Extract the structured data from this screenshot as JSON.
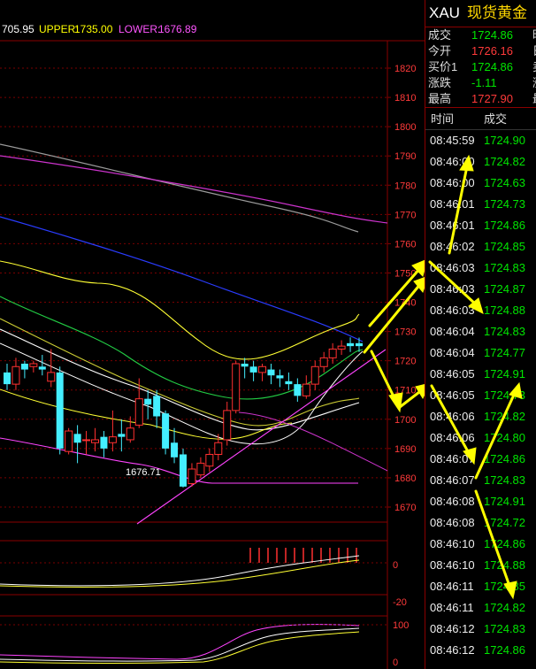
{
  "indicator": {
    "mid": "705.95",
    "upper_label": "UPPER:",
    "upper_value": "1735.00",
    "lower_label": "LOWER:",
    "lower_value": "1676.89",
    "colors": {
      "mid": "#ffffff",
      "upper": "#ffff00",
      "lower": "#ff55ff"
    }
  },
  "chart_data": {
    "type": "candlestick",
    "y_ticks": [
      "1820",
      "1810",
      "1800",
      "1790",
      "1780",
      "1770",
      "1760",
      "1750",
      "1740",
      "1730",
      "1720",
      "1710",
      "1700",
      "1690",
      "1680",
      "1670"
    ],
    "ylim": [
      1664,
      1825
    ],
    "min_marker": "1676.71",
    "candles": [
      {
        "o": 1716,
        "c": 1712,
        "h": 1719,
        "l": 1710
      },
      {
        "o": 1712,
        "c": 1718,
        "h": 1721,
        "l": 1710
      },
      {
        "o": 1719,
        "c": 1717,
        "h": 1720,
        "l": 1714
      },
      {
        "o": 1718,
        "c": 1719,
        "h": 1720,
        "l": 1716
      },
      {
        "o": 1718,
        "c": 1717,
        "h": 1722,
        "l": 1715
      },
      {
        "o": 1713,
        "c": 1716,
        "h": 1724,
        "l": 1711
      },
      {
        "o": 1716,
        "c": 1690,
        "h": 1718,
        "l": 1688
      },
      {
        "o": 1689,
        "c": 1696,
        "h": 1697,
        "l": 1688
      },
      {
        "o": 1695,
        "c": 1692,
        "h": 1698,
        "l": 1685
      },
      {
        "o": 1693,
        "c": 1693,
        "h": 1696,
        "l": 1688
      },
      {
        "o": 1692,
        "c": 1693,
        "h": 1697,
        "l": 1689
      },
      {
        "o": 1694,
        "c": 1690,
        "h": 1696,
        "l": 1687
      },
      {
        "o": 1692,
        "c": 1694,
        "h": 1703,
        "l": 1689
      },
      {
        "o": 1695,
        "c": 1694,
        "h": 1700,
        "l": 1689
      },
      {
        "o": 1693,
        "c": 1697,
        "h": 1701,
        "l": 1692
      },
      {
        "o": 1698,
        "c": 1707,
        "h": 1714,
        "l": 1697
      },
      {
        "o": 1707,
        "c": 1705,
        "h": 1710,
        "l": 1700
      },
      {
        "o": 1708,
        "c": 1701,
        "h": 1710,
        "l": 1697
      },
      {
        "o": 1702,
        "c": 1690,
        "h": 1703,
        "l": 1688
      },
      {
        "o": 1692,
        "c": 1687,
        "h": 1697,
        "l": 1685
      },
      {
        "o": 1688,
        "c": 1677,
        "h": 1690,
        "l": 1676.7
      },
      {
        "o": 1678,
        "c": 1683,
        "h": 1685,
        "l": 1677
      },
      {
        "o": 1681,
        "c": 1685,
        "h": 1687,
        "l": 1680
      },
      {
        "o": 1684,
        "c": 1688,
        "h": 1690,
        "l": 1682
      },
      {
        "o": 1688,
        "c": 1692,
        "h": 1695,
        "l": 1686
      },
      {
        "o": 1693,
        "c": 1703,
        "h": 1706,
        "l": 1691
      },
      {
        "o": 1703,
        "c": 1719,
        "h": 1720,
        "l": 1702
      },
      {
        "o": 1719,
        "c": 1718,
        "h": 1721,
        "l": 1714
      },
      {
        "o": 1718,
        "c": 1716,
        "h": 1720,
        "l": 1713
      },
      {
        "o": 1716,
        "c": 1718,
        "h": 1719,
        "l": 1713
      },
      {
        "o": 1717,
        "c": 1715,
        "h": 1719,
        "l": 1712
      },
      {
        "o": 1715,
        "c": 1714,
        "h": 1717,
        "l": 1711
      },
      {
        "o": 1713,
        "c": 1712,
        "h": 1716,
        "l": 1710
      },
      {
        "o": 1712,
        "c": 1708,
        "h": 1714,
        "l": 1706
      },
      {
        "o": 1708,
        "c": 1712,
        "h": 1715,
        "l": 1707
      },
      {
        "o": 1712,
        "c": 1718,
        "h": 1720,
        "l": 1710
      },
      {
        "o": 1718,
        "c": 1721,
        "h": 1723,
        "l": 1716
      },
      {
        "o": 1721,
        "c": 1724,
        "h": 1726,
        "l": 1719
      },
      {
        "o": 1724,
        "c": 1725,
        "h": 1727,
        "l": 1722
      },
      {
        "o": 1726,
        "c": 1725,
        "h": 1728,
        "l": 1723
      },
      {
        "o": 1726,
        "c": 1725,
        "h": 1727.9,
        "l": 1723
      }
    ],
    "sub1_ticks": [
      "0",
      "-20"
    ],
    "sub2_ticks": [
      "100",
      "0"
    ]
  },
  "quote": {
    "symbol": "XAU",
    "name": "现货黄金",
    "rows": [
      {
        "label": "成交",
        "value": "1724.86",
        "color": "dn",
        "cut": "昨"
      },
      {
        "label": "今开",
        "value": "1726.16",
        "color": "up",
        "cut": "日"
      },
      {
        "label": "买价1",
        "value": "1724.86",
        "color": "dn",
        "cut": "卖"
      },
      {
        "label": "涨跌",
        "value": "-1.11",
        "color": "dn",
        "cut": "涨"
      },
      {
        "label": "最高",
        "value": "1727.90",
        "color": "up",
        "cut": "最"
      }
    ]
  },
  "ticks": {
    "col_time": "时间",
    "col_price": "成交",
    "rows": [
      {
        "t": "08:45:59",
        "p": "1724.90",
        "c": "dn"
      },
      {
        "t": "08:46:00",
        "p": "1724.82",
        "c": "dn"
      },
      {
        "t": "08:46:00",
        "p": "1724.63",
        "c": "dn"
      },
      {
        "t": "08:46:01",
        "p": "1724.73",
        "c": "dn"
      },
      {
        "t": "08:46:01",
        "p": "1724.86",
        "c": "dn"
      },
      {
        "t": "08:46:02",
        "p": "1724.85",
        "c": "dn"
      },
      {
        "t": "08:46:03",
        "p": "1724.83",
        "c": "dn"
      },
      {
        "t": "08:46:03",
        "p": "1724.87",
        "c": "dn"
      },
      {
        "t": "08:46:03",
        "p": "1724.88",
        "c": "dn"
      },
      {
        "t": "08:46:04",
        "p": "1724.83",
        "c": "dn"
      },
      {
        "t": "08:46:04",
        "p": "1724.77",
        "c": "dn"
      },
      {
        "t": "08:46:05",
        "p": "1724.91",
        "c": "dn"
      },
      {
        "t": "08:46:05",
        "p": "1724.73",
        "c": "dn"
      },
      {
        "t": "08:46:06",
        "p": "1724.82",
        "c": "dn"
      },
      {
        "t": "08:46:06",
        "p": "1724.80",
        "c": "dn"
      },
      {
        "t": "08:46:07",
        "p": "1724.86",
        "c": "dn"
      },
      {
        "t": "08:46:07",
        "p": "1724.83",
        "c": "dn"
      },
      {
        "t": "08:46:08",
        "p": "1724.91",
        "c": "dn"
      },
      {
        "t": "08:46:08",
        "p": "1724.72",
        "c": "dn"
      },
      {
        "t": "08:46:10",
        "p": "1724.86",
        "c": "dn"
      },
      {
        "t": "08:46:10",
        "p": "1724.88",
        "c": "dn"
      },
      {
        "t": "08:46:11",
        "p": "1724.85",
        "c": "dn"
      },
      {
        "t": "08:46:11",
        "p": "1724.82",
        "c": "dn"
      },
      {
        "t": "08:46:12",
        "p": "1724.83",
        "c": "dn"
      },
      {
        "t": "08:46:12",
        "p": "1724.86",
        "c": "dn"
      }
    ]
  }
}
